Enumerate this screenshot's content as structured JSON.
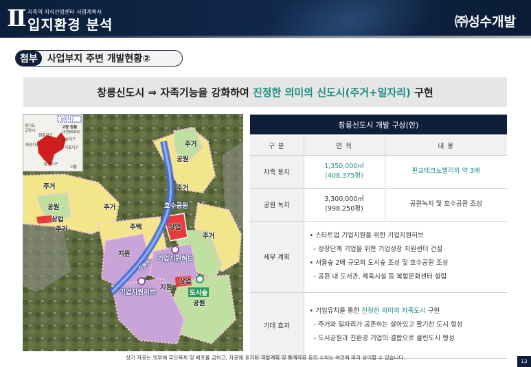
{
  "header": {
    "roman": "Ⅱ",
    "doc_subtitle": "지축역 지식산업센터 사업계획서",
    "section_title": "입지환경 분석",
    "company": "㈜성수개발"
  },
  "section": {
    "tag": "첨부",
    "title": "사업부지 주변 개발현황②"
  },
  "headline": {
    "pre": "창릉신도시 ⇒ 자족기능을 강화하여 ",
    "highlight": "진정한 의미의 신도시(주거+일자리)",
    "post": " 구현"
  },
  "map": {
    "inset": {
      "badge": "성동지구",
      "callout_line1": "고양 창릉",
      "callout_line2": "(3만8000)",
      "labels": [
        "경기도",
        "고양시",
        "화정지구",
        "원흥지구",
        "삼송지구",
        "지축지구",
        "향동지구",
        "서울"
      ]
    },
    "labels": {
      "residential": "주거",
      "park": "공원",
      "commercial": "상업",
      "housing": "주택",
      "lake_park": "호수공원",
      "support": "지원",
      "business_hub": "기업지원허브",
      "urban_forest": "도시숲",
      "stream": "창릉천"
    }
  },
  "table": {
    "title": "창릉신도시 개발 구상(안)",
    "headers": [
      "구 분",
      "면 적",
      "내 용"
    ],
    "rows": [
      {
        "label": "자족 용지",
        "area1": "1,350,000㎡",
        "area2": "(408,375평)",
        "content": "판교테크노밸리의 약 3배"
      },
      {
        "label": "공원 녹지",
        "area1": "3,300,000㎡",
        "area2": "(998,250평)",
        "content": "공원녹지 및 호수공원 조성"
      }
    ],
    "detail": {
      "label": "세부 계획",
      "lines": [
        "• 스타트업 기업지원을 위한 기업지원허브",
        "  - 성장단계 기업을 위한 기업성장 지원센터 건설",
        "• 서울숲 2배 규모의 도시숲 조성 및 호수공원 조성",
        "  - 공원 내 도서관, 체육시설 등 복합문화센터 설립"
      ]
    },
    "effect": {
      "label": "기대 효과",
      "line1_pre": "• 기업유치를 통한 ",
      "line1_hl": "진정한 의미의 자족도시",
      "line1_post": " 구현",
      "line2": "  - 주거와 일자리가 공존하는 살아있고 활기찬 도시 형성",
      "line3": "  - 도시공원과 친환경 기업의 결합으로 클린도시 형성"
    }
  },
  "footnote": "상기 자료는 외부에 무단복제 및 배포를 금하고, 자료에 표기된 개발계획 및 통계자료 등의 수치는 여건에 따라 상이할 수 있습니다.",
  "page_number": "13",
  "colors": {
    "navy": "#0f1f3a",
    "teal": "#1a8c84",
    "residential": "#f3e68a",
    "park": "#bfe0a0",
    "commercial": "#e83a3a",
    "support": "#c8a4d8",
    "road": "#4a6ad8"
  }
}
